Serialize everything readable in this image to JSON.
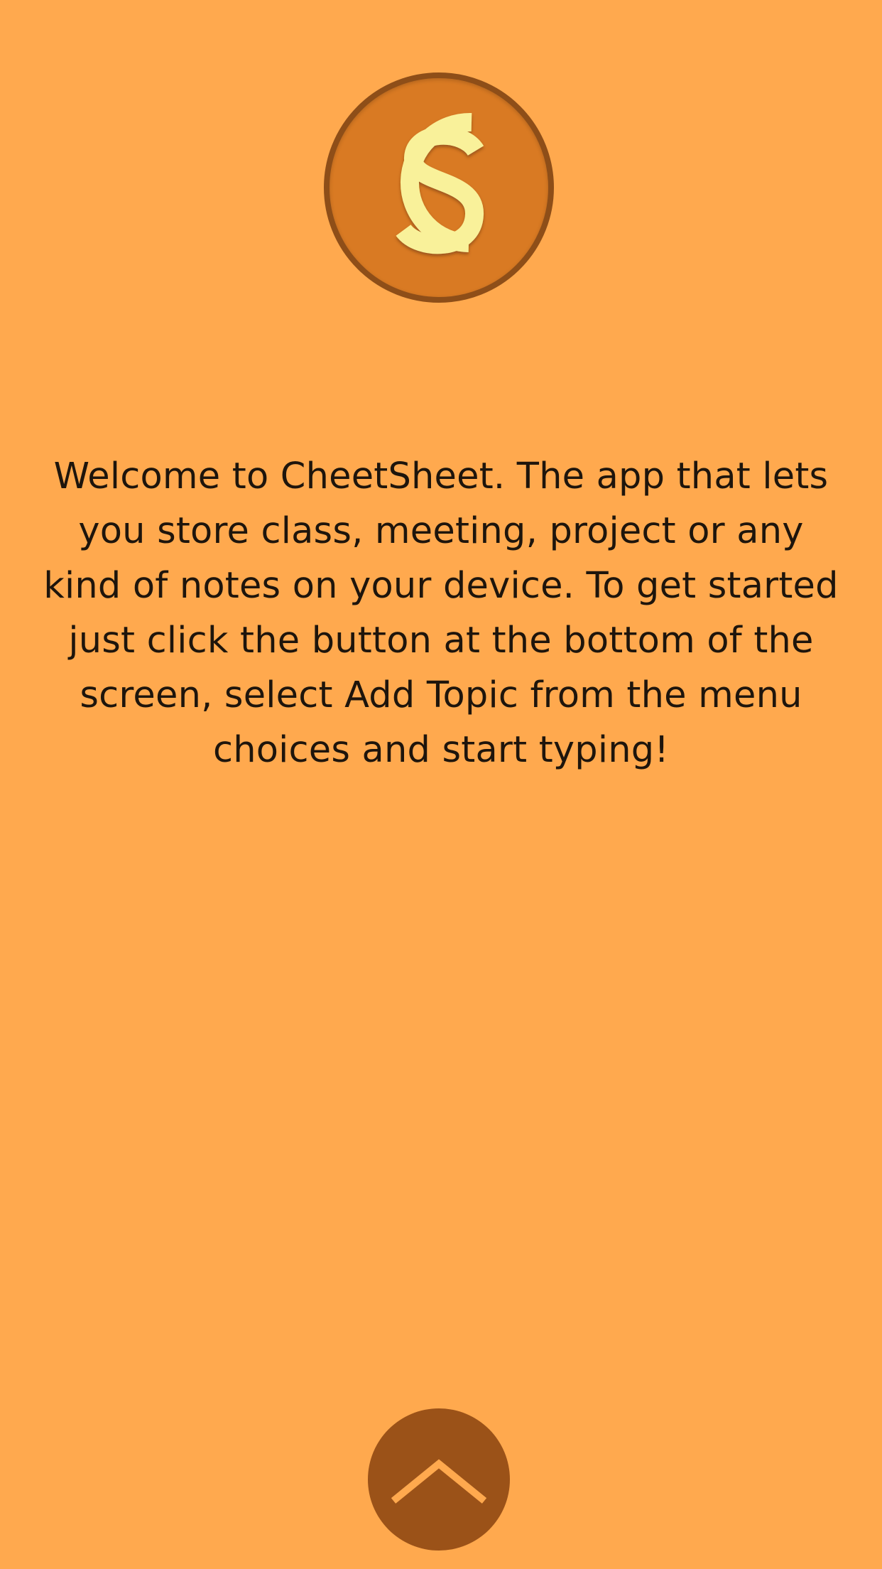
{
  "app": {
    "name": "CheetSheet",
    "logo_letters": "CS",
    "logo_icon": "cs-logo-icon"
  },
  "welcome": {
    "message": "Welcome to CheetSheet. The app that lets you store class, meeting, project or any kind of notes on your device. To get started just click the button at the bottom of the screen, select Add Topic from the menu choices and start typing!"
  },
  "menu_button": {
    "icon": "chevron-up-icon"
  },
  "colors": {
    "background": "#FFA94E",
    "logo_fill": "#D97A23",
    "logo_ring": "#8E4E18",
    "logo_letters": "#F9F19A",
    "button_fill": "#9B5218",
    "chevron": "#FFA94E",
    "text": "#1E150C"
  }
}
